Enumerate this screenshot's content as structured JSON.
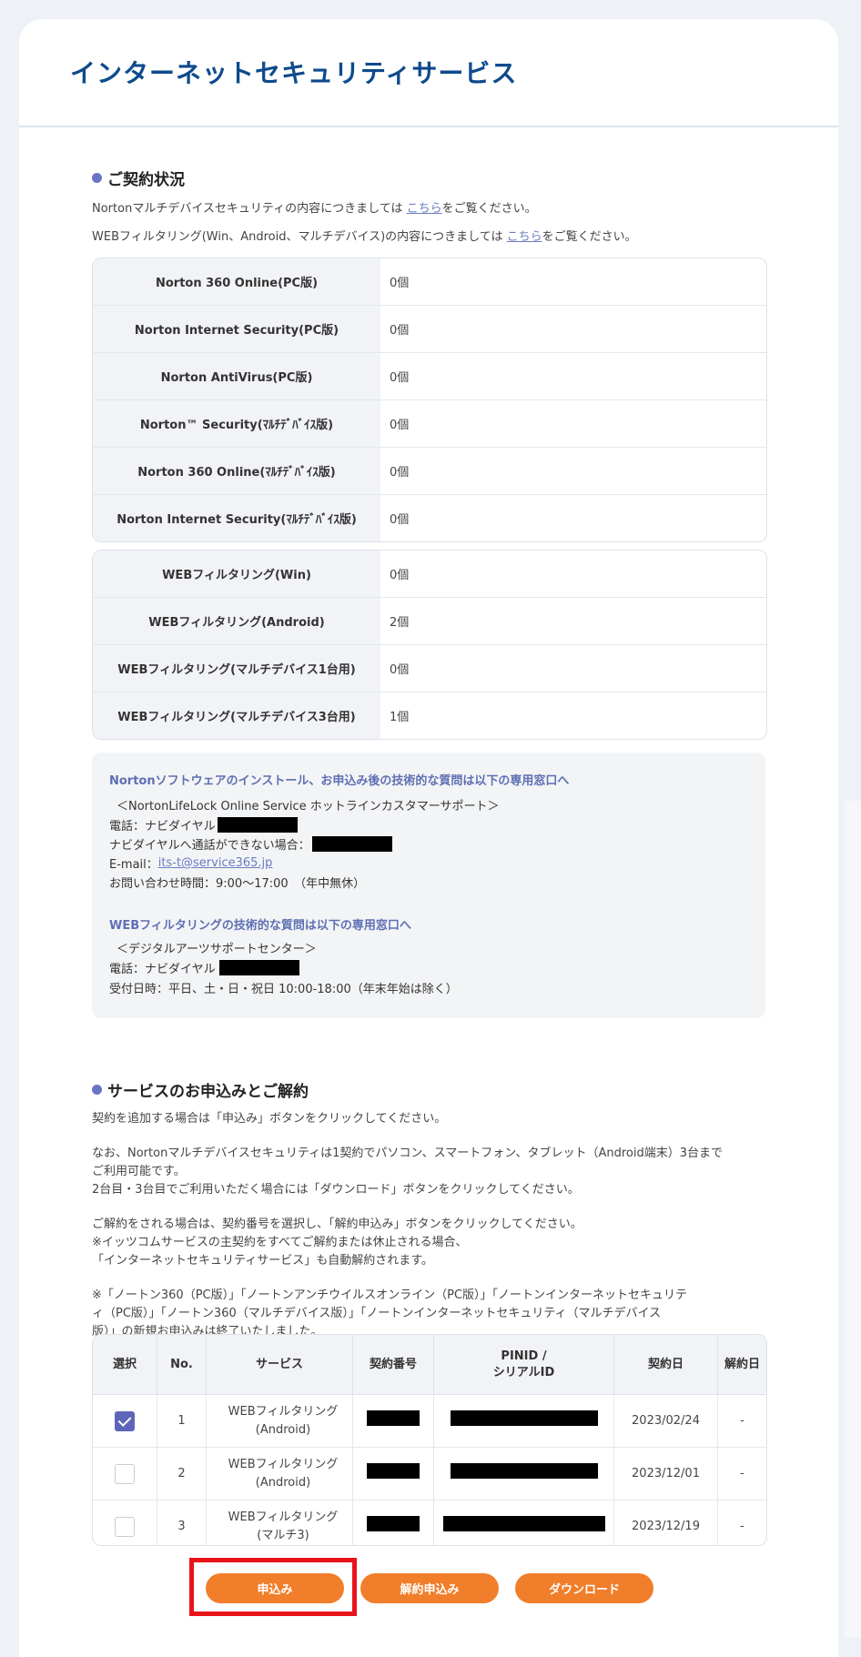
{
  "page_title": "インターネットセキュリティサービス",
  "contract_status": {
    "heading": "ご契約状況",
    "info_lines": [
      {
        "before": "Nortonマルチデバイスセキュリティの内容につきましては ",
        "link": "こちら",
        "after": "をご覧ください。"
      },
      {
        "before": "WEBフィルタリング(Win、Android、マルチデバイス)の内容につきましては ",
        "link": "こちら",
        "after": "をご覧ください。"
      }
    ],
    "norton_products": [
      {
        "name": "Norton 360 Online(PC版)",
        "count": "0個"
      },
      {
        "name": "Norton Internet Security(PC版)",
        "count": "0個"
      },
      {
        "name": "Norton AntiVirus(PC版)",
        "count": "0個"
      },
      {
        "name": "Norton™ Security(ﾏﾙﾁﾃﾞﾊﾞｲｽ版)",
        "count": "0個"
      },
      {
        "name": "Norton 360 Online(ﾏﾙﾁﾃﾞﾊﾞｲｽ版)",
        "count": "0個"
      },
      {
        "name": "Norton Internet Security(ﾏﾙﾁﾃﾞﾊﾞｲｽ版)",
        "count": "0個"
      }
    ],
    "web_filtering": [
      {
        "name": "WEBフィルタリング(Win)",
        "count": "0個"
      },
      {
        "name": "WEBフィルタリング(Android)",
        "count": "2個"
      },
      {
        "name": "WEBフィルタリング(マルチデバイス1台用)",
        "count": "0個"
      },
      {
        "name": "WEBフィルタリング(マルチデバイス3台用)",
        "count": "1個"
      }
    ]
  },
  "support": {
    "norton_heading": "Nortonソフトウェアのインストール、お申込み後の技術的な質問は以下の専用窓口へ",
    "norton_center": "＜NortonLifeLock Online Service ホットラインカスタマーサポート＞",
    "norton_phone_label": "電話：ナビダイヤル",
    "norton_alt_label": "ナビダイヤルへ通話ができない場合：",
    "email_label": "E-mail：",
    "email": "its-t@service365.jp",
    "norton_hours": "お問い合わせ時間：9:00〜17:00　（年中無休）",
    "web_heading": "WEBフィルタリングの技術的な質問は以下の専用窓口へ",
    "web_center": "＜デジタルアーツサポートセンター＞",
    "web_phone_label": "電話：ナビダイヤル",
    "web_hours": "受付日時：平日、土・日・祝日 10:00-18:00（年末年始は除く）"
  },
  "service_section": {
    "heading": "サービスのお申込みとご解約",
    "p1": "契約を追加する場合は「申込み」ボタンをクリックしてください。",
    "p2a": "なお、Nortonマルチデバイスセキュリティは1契約でパソコン、スマートフォン、タブレット（Android端末）3台まで",
    "p2b": "ご利用可能です。",
    "p2c": "2台目・3台目でご利用いただく場合には「ダウンロード」ボタンをクリックしてください。",
    "p3a": "ご解約をされる場合は、契約番号を選択し、「解約申込み」ボタンをクリックしてください。",
    "p3b": "※イッツコムサービスの主契約をすべてご解約または休止される場合、",
    "p3c": "「インターネットセキュリティサービス」も自動解約されます。",
    "p4a": "※「ノートン360（PC版）」「ノートンアンチウイルスオンライン（PC版）」「ノートンインターネットセキュリテ",
    "p4b": "ィ（PC版）」「ノートン360（マルチデバイス版）」「ノートンインターネットセキュリティ（マルチデバイス",
    "p4c": "版）」の新規お申込みは終了いたしました。"
  },
  "contracts_table": {
    "headers": {
      "select": "選択",
      "no": "No.",
      "service": "サービス",
      "contract_no": "契約番号",
      "pin_line1": "PINID /",
      "pin_line2": "シリアルID",
      "contract_date": "契約日",
      "cancel_date": "解約日"
    },
    "rows": [
      {
        "checked": true,
        "no": "1",
        "service_line1": "WEBフィルタリング",
        "service_line2": "(Android)",
        "date": "2023/02/24",
        "cancel": "-"
      },
      {
        "checked": false,
        "no": "2",
        "service_line1": "WEBフィルタリング",
        "service_line2": "(Android)",
        "date": "2023/12/01",
        "cancel": "-"
      },
      {
        "checked": false,
        "no": "3",
        "service_line1": "WEBフィルタリング",
        "service_line2": "(マルチ3)",
        "date": "2023/12/19",
        "cancel": "-"
      }
    ]
  },
  "buttons": {
    "apply": "申込み",
    "cancel_apply": "解約申込み",
    "download": "ダウンロード"
  },
  "colors": {
    "title": "#0e4a8c",
    "accent_dot": "#6b73c4",
    "button": "#f17e2a",
    "highlight": "#e8141a",
    "checkbox": "#5d66b8"
  }
}
